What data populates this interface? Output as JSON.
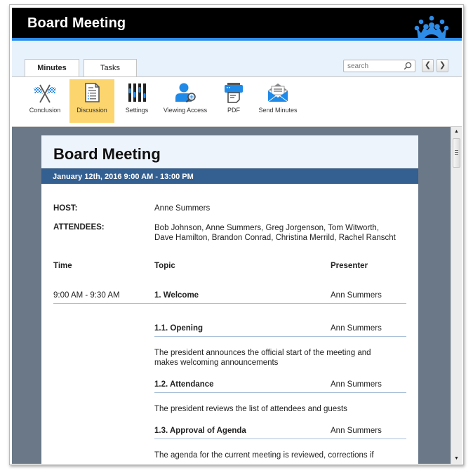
{
  "window": {
    "app_title": "Board Meeting",
    "logo_icon": "crown-people-logo",
    "brand_color": "#2d8ce8"
  },
  "tabs": [
    {
      "label": "Minutes",
      "active": true
    },
    {
      "label": "Tasks",
      "active": false
    }
  ],
  "search": {
    "placeholder": "search",
    "value": ""
  },
  "nav": {
    "prev": "❮",
    "next": "❯"
  },
  "ribbon": [
    {
      "label": "Conclusion",
      "icon": "checkered-flags-icon",
      "active": false
    },
    {
      "label": "Discussion",
      "icon": "document-icon",
      "active": true
    },
    {
      "label": "Settings",
      "icon": "sliders-icon",
      "active": false
    },
    {
      "label": "Viewing Access",
      "icon": "user-search-icon",
      "active": false
    },
    {
      "label": "PDF",
      "icon": "printer-icon",
      "active": false
    },
    {
      "label": "Send Minutes",
      "icon": "envelope-icon",
      "active": false
    }
  ],
  "document": {
    "title": "Board Meeting",
    "date_line": "January 12th, 2016  9:00 AM - 13:00 PM",
    "host_label": "HOST:",
    "host": "Anne Summers",
    "attendees_label": "ATTENDEES:",
    "attendees_line1": "Bob Johnson, Anne Summers, Greg Jorgenson, Tom Witworth,",
    "attendees_line2": "Dave Hamilton, Brandon Conrad, Christina Merrild, Rachel Ranscht",
    "columns": {
      "time": "Time",
      "topic": "Topic",
      "presenter": "Presenter"
    },
    "agenda": [
      {
        "time": "9:00 AM - 9:30 AM",
        "topic": "1. Welcome",
        "presenter": "Ann Summers",
        "description": ""
      },
      {
        "time": "",
        "topic": "1.1. Opening",
        "presenter": "Ann Summers",
        "description_line1": "The president announces the official start of the meeting and",
        "description_line2": "makes welcoming announcements"
      },
      {
        "time": "",
        "topic": "1.2. Attendance",
        "presenter": "Ann Summers",
        "description_line1": "The president reviews the list of attendees and guests"
      },
      {
        "time": "",
        "topic": "1.3. Approval of Agenda",
        "presenter": "Ann Summers",
        "description_line1": "The agenda for the current meeting is reviewed, corrections if"
      }
    ]
  },
  "scrollbar": {
    "up": "▲",
    "down": "▼"
  }
}
